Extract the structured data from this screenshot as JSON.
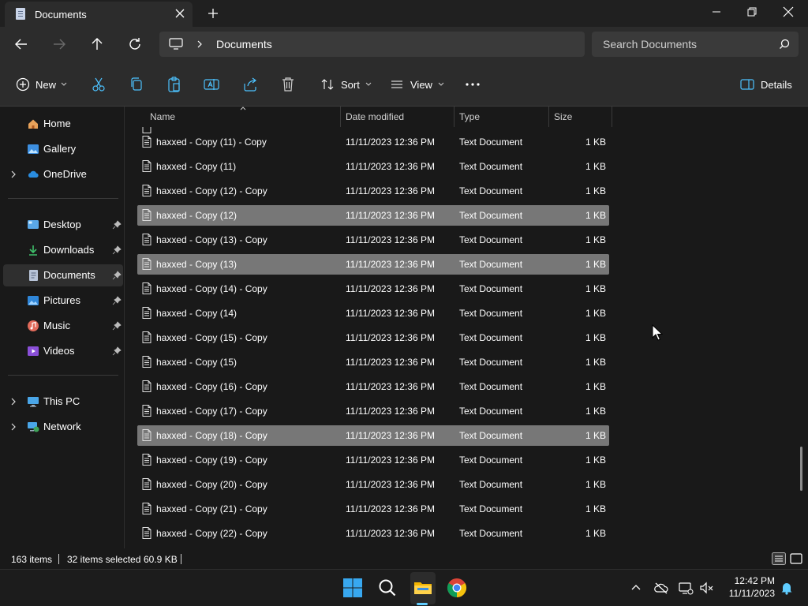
{
  "window": {
    "tab_title": "Documents"
  },
  "address": {
    "path": "Documents",
    "search_placeholder": "Search Documents"
  },
  "toolbar": {
    "new_label": "New",
    "sort_label": "Sort",
    "view_label": "View",
    "details_label": "Details"
  },
  "sidebar": {
    "items": [
      {
        "label": "Home"
      },
      {
        "label": "Gallery"
      },
      {
        "label": "OneDrive"
      },
      {
        "label": "Desktop"
      },
      {
        "label": "Downloads"
      },
      {
        "label": "Documents"
      },
      {
        "label": "Pictures"
      },
      {
        "label": "Music"
      },
      {
        "label": "Videos"
      },
      {
        "label": "This PC"
      },
      {
        "label": "Network"
      }
    ]
  },
  "columns": {
    "name": "Name",
    "date": "Date modified",
    "type": "Type",
    "size": "Size"
  },
  "files": [
    {
      "name": "haxxed - Copy (11) - Copy",
      "date": "11/11/2023 12:36 PM",
      "type": "Text Document",
      "size": "1 KB",
      "selected": false
    },
    {
      "name": "haxxed - Copy (11)",
      "date": "11/11/2023 12:36 PM",
      "type": "Text Document",
      "size": "1 KB",
      "selected": false
    },
    {
      "name": "haxxed - Copy (12) - Copy",
      "date": "11/11/2023 12:36 PM",
      "type": "Text Document",
      "size": "1 KB",
      "selected": false
    },
    {
      "name": "haxxed - Copy (12)",
      "date": "11/11/2023 12:36 PM",
      "type": "Text Document",
      "size": "1 KB",
      "selected": true
    },
    {
      "name": "haxxed - Copy (13) - Copy",
      "date": "11/11/2023 12:36 PM",
      "type": "Text Document",
      "size": "1 KB",
      "selected": false
    },
    {
      "name": "haxxed - Copy (13)",
      "date": "11/11/2023 12:36 PM",
      "type": "Text Document",
      "size": "1 KB",
      "selected": true
    },
    {
      "name": "haxxed - Copy (14) - Copy",
      "date": "11/11/2023 12:36 PM",
      "type": "Text Document",
      "size": "1 KB",
      "selected": false
    },
    {
      "name": "haxxed - Copy (14)",
      "date": "11/11/2023 12:36 PM",
      "type": "Text Document",
      "size": "1 KB",
      "selected": false
    },
    {
      "name": "haxxed - Copy (15) - Copy",
      "date": "11/11/2023 12:36 PM",
      "type": "Text Document",
      "size": "1 KB",
      "selected": false
    },
    {
      "name": "haxxed - Copy (15)",
      "date": "11/11/2023 12:36 PM",
      "type": "Text Document",
      "size": "1 KB",
      "selected": false
    },
    {
      "name": "haxxed - Copy (16) - Copy",
      "date": "11/11/2023 12:36 PM",
      "type": "Text Document",
      "size": "1 KB",
      "selected": false
    },
    {
      "name": "haxxed - Copy (17) - Copy",
      "date": "11/11/2023 12:36 PM",
      "type": "Text Document",
      "size": "1 KB",
      "selected": false
    },
    {
      "name": "haxxed - Copy (18) - Copy",
      "date": "11/11/2023 12:36 PM",
      "type": "Text Document",
      "size": "1 KB",
      "selected": true
    },
    {
      "name": "haxxed - Copy (19) - Copy",
      "date": "11/11/2023 12:36 PM",
      "type": "Text Document",
      "size": "1 KB",
      "selected": false
    },
    {
      "name": "haxxed - Copy (20) - Copy",
      "date": "11/11/2023 12:36 PM",
      "type": "Text Document",
      "size": "1 KB",
      "selected": false
    },
    {
      "name": "haxxed - Copy (21) - Copy",
      "date": "11/11/2023 12:36 PM",
      "type": "Text Document",
      "size": "1 KB",
      "selected": false
    },
    {
      "name": "haxxed - Copy (22) - Copy",
      "date": "11/11/2023 12:36 PM",
      "type": "Text Document",
      "size": "1 KB",
      "selected": false
    }
  ],
  "status": {
    "item_count": "163 items",
    "selection": "32 items selected",
    "selection_size": "60.9 KB"
  },
  "clock": {
    "time": "12:42 PM",
    "date": "11/11/2023"
  },
  "colors": {
    "selection": "#777777",
    "accent": "#60cdff"
  }
}
